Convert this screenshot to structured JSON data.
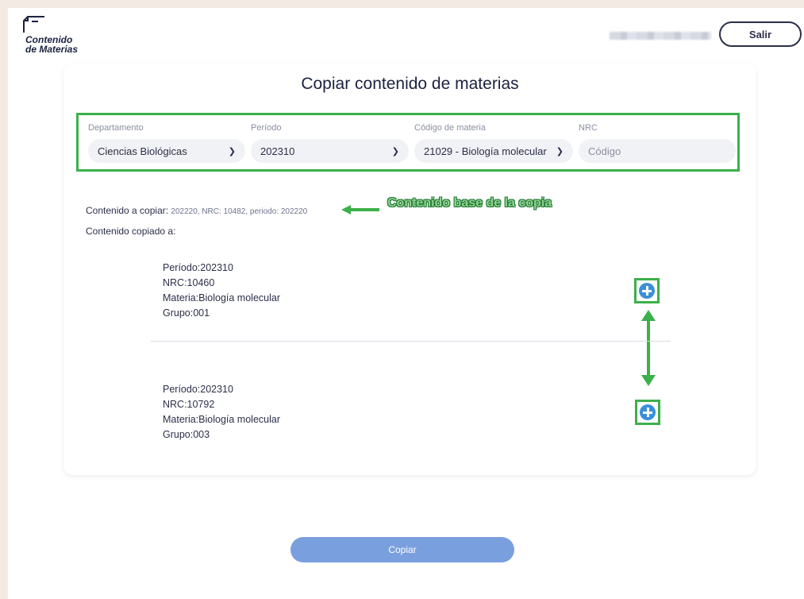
{
  "header": {
    "logo_line1": "Contenido",
    "logo_line2": "de Materias",
    "logout_label": "Salir"
  },
  "main": {
    "title": "Copiar contenido de materias",
    "filters": {
      "department_label": "Departamento",
      "department_value": "Ciencias Biológicas",
      "period_label": "Período",
      "period_value": "202310",
      "course_code_label": "Código de materia",
      "course_code_value": "21029 - Biología molecular",
      "nrc_label": "NRC",
      "nrc_placeholder": "Código"
    },
    "source_label": "Contenido a copiar: ",
    "source_value": "202220, NRC: 10482, periodo: 202220",
    "copied_to_label": "Contenido copiado a:",
    "annotation_text": "Contenido base de la copia",
    "items": [
      {
        "periodo": "Período:202310",
        "nrc": "NRC:10460",
        "materia": "Materia:Biología molecular",
        "grupo": "Grupo:001"
      },
      {
        "periodo": "Período:202310",
        "nrc": "NRC:10792",
        "materia": "Materia:Biología molecular",
        "grupo": "Grupo:003"
      }
    ],
    "copy_button": "Copiar"
  },
  "colors": {
    "accent": "#7a9fde",
    "highlight": "#3cb04a",
    "add_icon": "#3a8fd8",
    "background": "#f3ebe3"
  },
  "icons": [
    "document-logo-icon",
    "chevron-down-icon",
    "add-circle-icon",
    "left-arrow-icon",
    "double-arrow-icon"
  ]
}
